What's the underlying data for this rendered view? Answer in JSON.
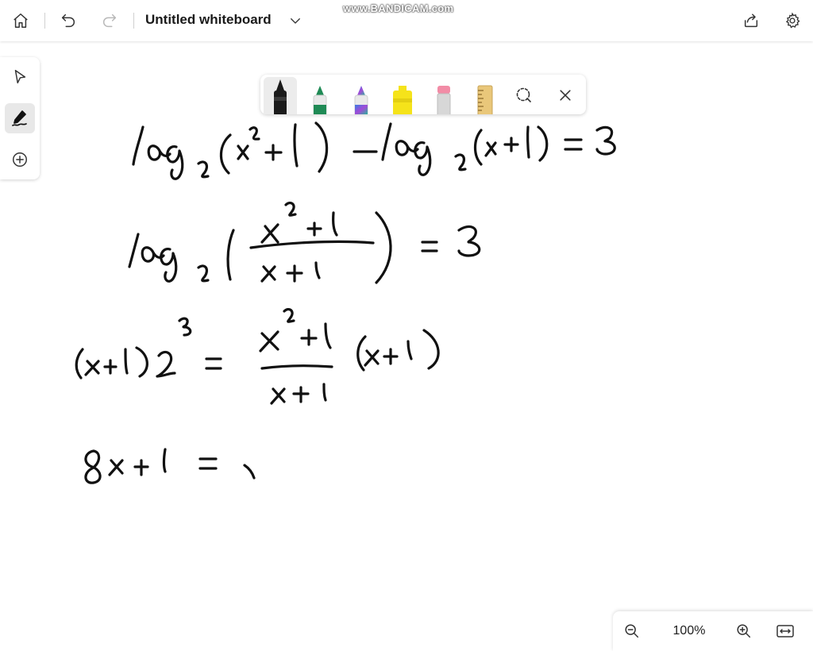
{
  "app": {
    "title": "Untitled whiteboard",
    "watermark": "www.BANDICAM.com"
  },
  "topbar": {
    "icons": [
      "home-icon",
      "undo-icon",
      "redo-icon",
      "chevron-down-icon",
      "share-icon",
      "gear-icon"
    ]
  },
  "left_tools": [
    "select-pointer-icon",
    "pen-draw-icon",
    "add-circle-icon"
  ],
  "pen_toolbar": {
    "pens": [
      {
        "name": "black-pen",
        "color": "#1b1b1b",
        "active": true
      },
      {
        "name": "green-pen",
        "color": "#1f8a55",
        "active": false
      },
      {
        "name": "galaxy-pen",
        "color": "#6b5bd6",
        "active": false
      },
      {
        "name": "yellow-highlighter",
        "color": "#f5e31a",
        "active": false
      },
      {
        "name": "eraser",
        "color": "#f28ca6",
        "active": false
      },
      {
        "name": "ruler",
        "color": "#e9c77a",
        "active": false
      }
    ],
    "icons": [
      "lasso-select-icon",
      "close-icon"
    ]
  },
  "zoom": {
    "value": "100%",
    "icons": [
      "zoom-out-icon",
      "zoom-in-icon",
      "fit-width-icon"
    ]
  },
  "colors": {
    "ink": "#111111",
    "toolbar_bg": "#ffffff",
    "active_bg": "#e8e8e8"
  }
}
